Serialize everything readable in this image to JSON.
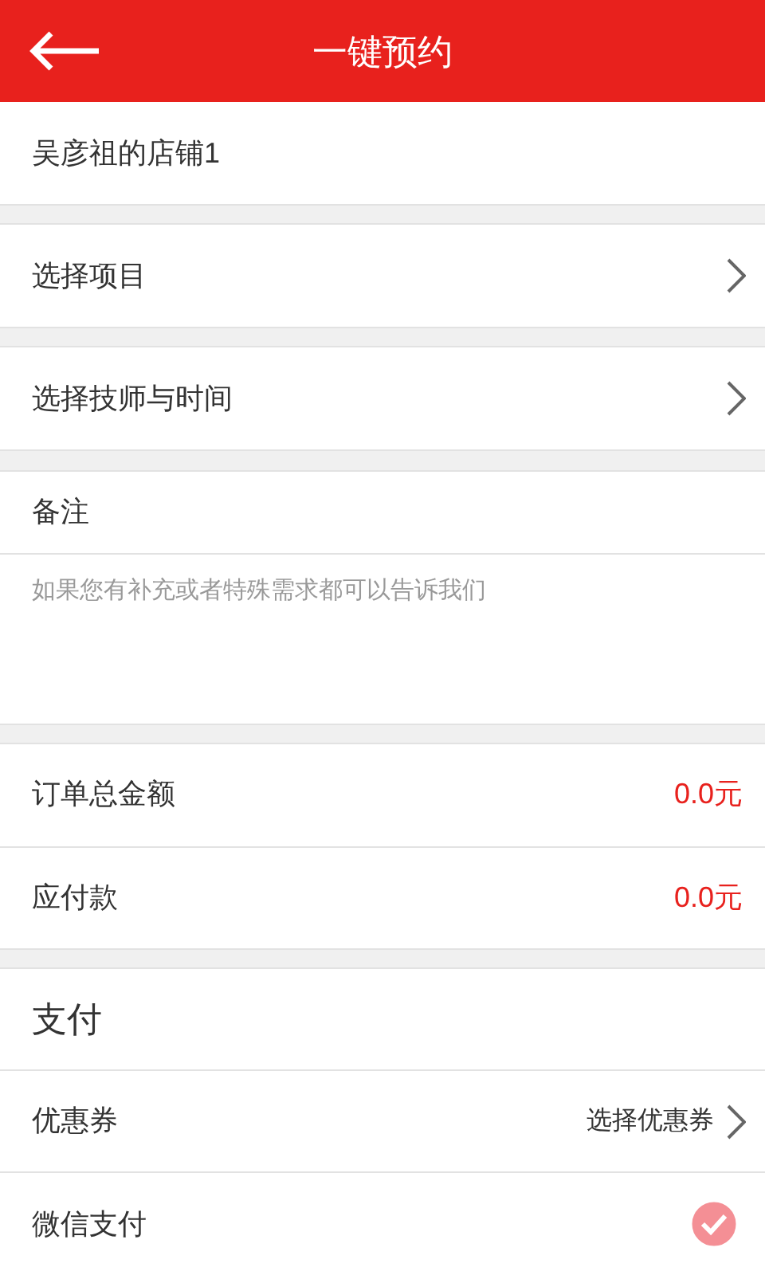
{
  "header": {
    "title": "一键预约"
  },
  "shop": {
    "name": "吴彦祖的店铺1"
  },
  "selectors": [
    {
      "label": "选择项目"
    },
    {
      "label": "选择技师与时间"
    }
  ],
  "remark": {
    "title": "备注",
    "placeholder": "如果您有补充或者特殊需求都可以告诉我们"
  },
  "amounts": [
    {
      "label": "订单总金额",
      "value": "0.0元"
    },
    {
      "label": "应付款",
      "value": "0.0元"
    }
  ],
  "payment": {
    "title": "支付",
    "coupon": {
      "label": "优惠券",
      "action": "选择优惠券"
    },
    "methods": [
      {
        "label": "微信支付",
        "checked": true
      }
    ]
  }
}
